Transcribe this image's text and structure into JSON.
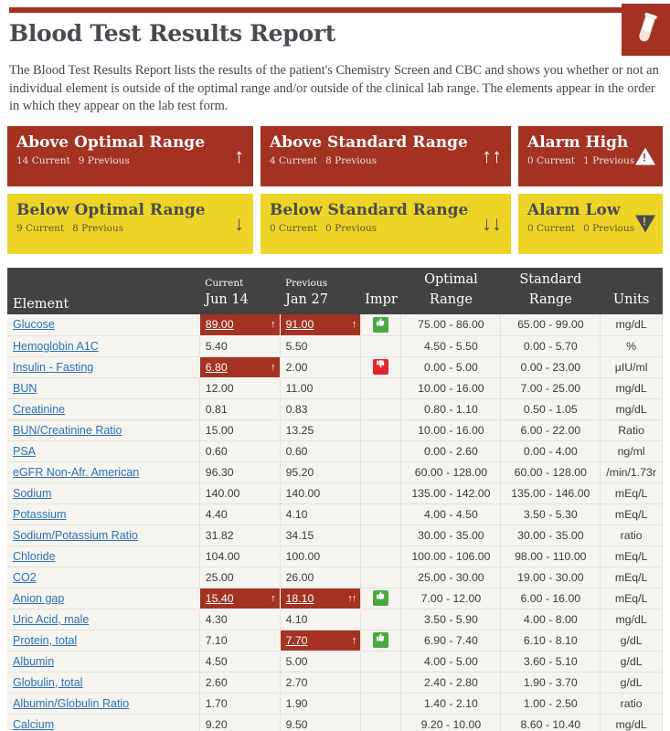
{
  "header": {
    "title": "Blood Test Results Report",
    "logo_icon": "test-tube-icon",
    "intro": "The Blood Test Results Report lists the results of the patient's Chemistry Screen and CBC and shows you whether or not an individual element is outside of the optimal range and/or outside of the clinical lab range. The elements appear in the order in which they appear on the lab test form."
  },
  "colors": {
    "red": "#a33223",
    "amber": "#edd527",
    "header_gray": "#424242",
    "optimal_green": "#ccd3a7",
    "row_bg": "#f5f4ef",
    "link_blue": "#2a72b5",
    "thumb_up_green": "#49a842",
    "thumb_down_red": "#e4242c"
  },
  "cards": [
    {
      "title": "Above Optimal Range",
      "current": "14 Current",
      "previous": "9 Previous",
      "indicator": "up-arrow",
      "glyph": "↑",
      "style": "red",
      "icon_name": "arrow-up-icon"
    },
    {
      "title": "Above Standard Range",
      "current": "4 Current",
      "previous": "8 Previous",
      "indicator": "double-up-arrow",
      "glyph": "↑↑",
      "style": "red",
      "icon_name": "double-arrow-up-icon"
    },
    {
      "title": "Alarm High",
      "current": "0 Current",
      "previous": "1 Previous",
      "indicator": "warning-triangle-up",
      "glyph": "",
      "style": "red",
      "icon_name": "alarm-high-icon"
    },
    {
      "title": "Below Optimal Range",
      "current": "9 Current",
      "previous": "8 Previous",
      "indicator": "down-arrow",
      "glyph": "↓",
      "style": "amber",
      "icon_name": "arrow-down-icon"
    },
    {
      "title": "Below Standard Range",
      "current": "0 Current",
      "previous": "0 Previous",
      "indicator": "double-down-arrow",
      "glyph": "↓↓",
      "style": "amber",
      "icon_name": "double-arrow-down-icon"
    },
    {
      "title": "Alarm Low",
      "current": "0 Current",
      "previous": "0 Previous",
      "indicator": "warning-triangle-down",
      "glyph": "",
      "style": "amber",
      "icon_name": "alarm-low-icon"
    }
  ],
  "table": {
    "headers": {
      "element": "Element",
      "current_top": "Current",
      "current_date": "Jun 14",
      "previous_top": "Previous",
      "previous_date": "Jan 27",
      "impr": "Impr",
      "optimal": "Optimal Range",
      "standard": "Standard Range",
      "units": "Units"
    },
    "rows": [
      {
        "element": "Glucose",
        "current": "89.00",
        "cur_flag": "above-optimal",
        "cur_arrow": "↑",
        "previous": "91.00",
        "prev_flag": "above-optimal",
        "prev_arrow": "↑",
        "impr": "up",
        "optimal": "75.00 - 86.00",
        "standard": "65.00 - 99.00",
        "units": "mg/dL"
      },
      {
        "element": "Hemoglobin A1C",
        "current": "5.40",
        "cur_flag": "",
        "cur_arrow": "",
        "previous": "5.50",
        "prev_flag": "",
        "prev_arrow": "",
        "impr": "",
        "optimal": "4.50 - 5.50",
        "standard": "0.00 - 5.70",
        "units": "%"
      },
      {
        "element": "Insulin - Fasting",
        "current": "6.80",
        "cur_flag": "above-optimal",
        "cur_arrow": "↑",
        "previous": "2.00",
        "prev_flag": "",
        "prev_arrow": "",
        "impr": "down",
        "optimal": "0.00 - 5.00",
        "standard": "0.00 - 23.00",
        "units": "µIU/ml"
      },
      {
        "element": "BUN",
        "current": "12.00",
        "cur_flag": "",
        "cur_arrow": "",
        "previous": "11.00",
        "prev_flag": "",
        "prev_arrow": "",
        "impr": "",
        "optimal": "10.00 - 16.00",
        "standard": "7.00 - 25.00",
        "units": "mg/dL"
      },
      {
        "element": "Creatinine",
        "current": "0.81",
        "cur_flag": "",
        "cur_arrow": "",
        "previous": "0.83",
        "prev_flag": "",
        "prev_arrow": "",
        "impr": "",
        "optimal": "0.80 - 1.10",
        "standard": "0.50 - 1.05",
        "units": "mg/dL"
      },
      {
        "element": "BUN/Creatinine Ratio",
        "current": "15.00",
        "cur_flag": "",
        "cur_arrow": "",
        "previous": "13.25",
        "prev_flag": "",
        "prev_arrow": "",
        "impr": "",
        "optimal": "10.00 - 16.00",
        "standard": "6.00 - 22.00",
        "units": "Ratio"
      },
      {
        "element": "PSA",
        "current": "0.60",
        "cur_flag": "",
        "cur_arrow": "",
        "previous": "0.60",
        "prev_flag": "",
        "prev_arrow": "",
        "impr": "",
        "optimal": "0.00 - 2.60",
        "standard": "0.00 - 4.00",
        "units": "ng/ml"
      },
      {
        "element": "eGFR Non-Afr. American",
        "current": "96.30",
        "cur_flag": "",
        "cur_arrow": "",
        "previous": "95.20",
        "prev_flag": "",
        "prev_arrow": "",
        "impr": "",
        "optimal": "60.00 - 128.00",
        "standard": "60.00 - 128.00",
        "units": "/min/1.73r"
      },
      {
        "element": "Sodium",
        "current": "140.00",
        "cur_flag": "",
        "cur_arrow": "",
        "previous": "140.00",
        "prev_flag": "",
        "prev_arrow": "",
        "impr": "",
        "optimal": "135.00 - 142.00",
        "standard": "135.00 - 146.00",
        "units": "mEq/L"
      },
      {
        "element": "Potassium",
        "current": "4.40",
        "cur_flag": "",
        "cur_arrow": "",
        "previous": "4.10",
        "prev_flag": "",
        "prev_arrow": "",
        "impr": "",
        "optimal": "4.00 - 4.50",
        "standard": "3.50 - 5.30",
        "units": "mEq/L"
      },
      {
        "element": "Sodium/Potassium Ratio",
        "current": "31.82",
        "cur_flag": "",
        "cur_arrow": "",
        "previous": "34.15",
        "prev_flag": "",
        "prev_arrow": "",
        "impr": "",
        "optimal": "30.00 - 35.00",
        "standard": "30.00 - 35.00",
        "units": "ratio"
      },
      {
        "element": "Chloride",
        "current": "104.00",
        "cur_flag": "",
        "cur_arrow": "",
        "previous": "100.00",
        "prev_flag": "",
        "prev_arrow": "",
        "impr": "",
        "optimal": "100.00 - 106.00",
        "standard": "98.00 - 110.00",
        "units": "mEq/L"
      },
      {
        "element": "CO2",
        "current": "25.00",
        "cur_flag": "",
        "cur_arrow": "",
        "previous": "26.00",
        "prev_flag": "",
        "prev_arrow": "",
        "impr": "",
        "optimal": "25.00 - 30.00",
        "standard": "19.00 - 30.00",
        "units": "mEq/L"
      },
      {
        "element": "Anion gap",
        "current": "15.40",
        "cur_flag": "above-optimal",
        "cur_arrow": "↑",
        "previous": "18.10",
        "prev_flag": "above-optimal",
        "prev_arrow": "↑↑",
        "impr": "up",
        "optimal": "7.00 - 12.00",
        "standard": "6.00 - 16.00",
        "units": "mEq/L"
      },
      {
        "element": "Uric Acid, male",
        "current": "4.30",
        "cur_flag": "",
        "cur_arrow": "",
        "previous": "4.10",
        "prev_flag": "",
        "prev_arrow": "",
        "impr": "",
        "optimal": "3.50 - 5.90",
        "standard": "4.00 - 8.00",
        "units": "mg/dL"
      },
      {
        "element": "Protein, total",
        "current": "7.10",
        "cur_flag": "",
        "cur_arrow": "",
        "previous": "7.70",
        "prev_flag": "above-optimal",
        "prev_arrow": "↑",
        "impr": "up",
        "optimal": "6.90 - 7.40",
        "standard": "6.10 - 8.10",
        "units": "g/dL"
      },
      {
        "element": "Albumin",
        "current": "4.50",
        "cur_flag": "",
        "cur_arrow": "",
        "previous": "5.00",
        "prev_flag": "",
        "prev_arrow": "",
        "impr": "",
        "optimal": "4.00 - 5.00",
        "standard": "3.60 - 5.10",
        "units": "g/dL"
      },
      {
        "element": "Globulin, total",
        "current": "2.60",
        "cur_flag": "",
        "cur_arrow": "",
        "previous": "2.70",
        "prev_flag": "",
        "prev_arrow": "",
        "impr": "",
        "optimal": "2.40 - 2.80",
        "standard": "1.90 - 3.70",
        "units": "g/dL"
      },
      {
        "element": "Albumin/Globulin Ratio",
        "current": "1.70",
        "cur_flag": "",
        "cur_arrow": "",
        "previous": "1.90",
        "prev_flag": "",
        "prev_arrow": "",
        "impr": "",
        "optimal": "1.40 - 2.10",
        "standard": "1.00 - 2.50",
        "units": "ratio"
      },
      {
        "element": "Calcium",
        "current": "9.20",
        "cur_flag": "",
        "cur_arrow": "",
        "previous": "9.50",
        "prev_flag": "",
        "prev_arrow": "",
        "impr": "",
        "optimal": "9.20 - 10.00",
        "standard": "8.60 - 10.40",
        "units": "mg/dL"
      }
    ]
  }
}
